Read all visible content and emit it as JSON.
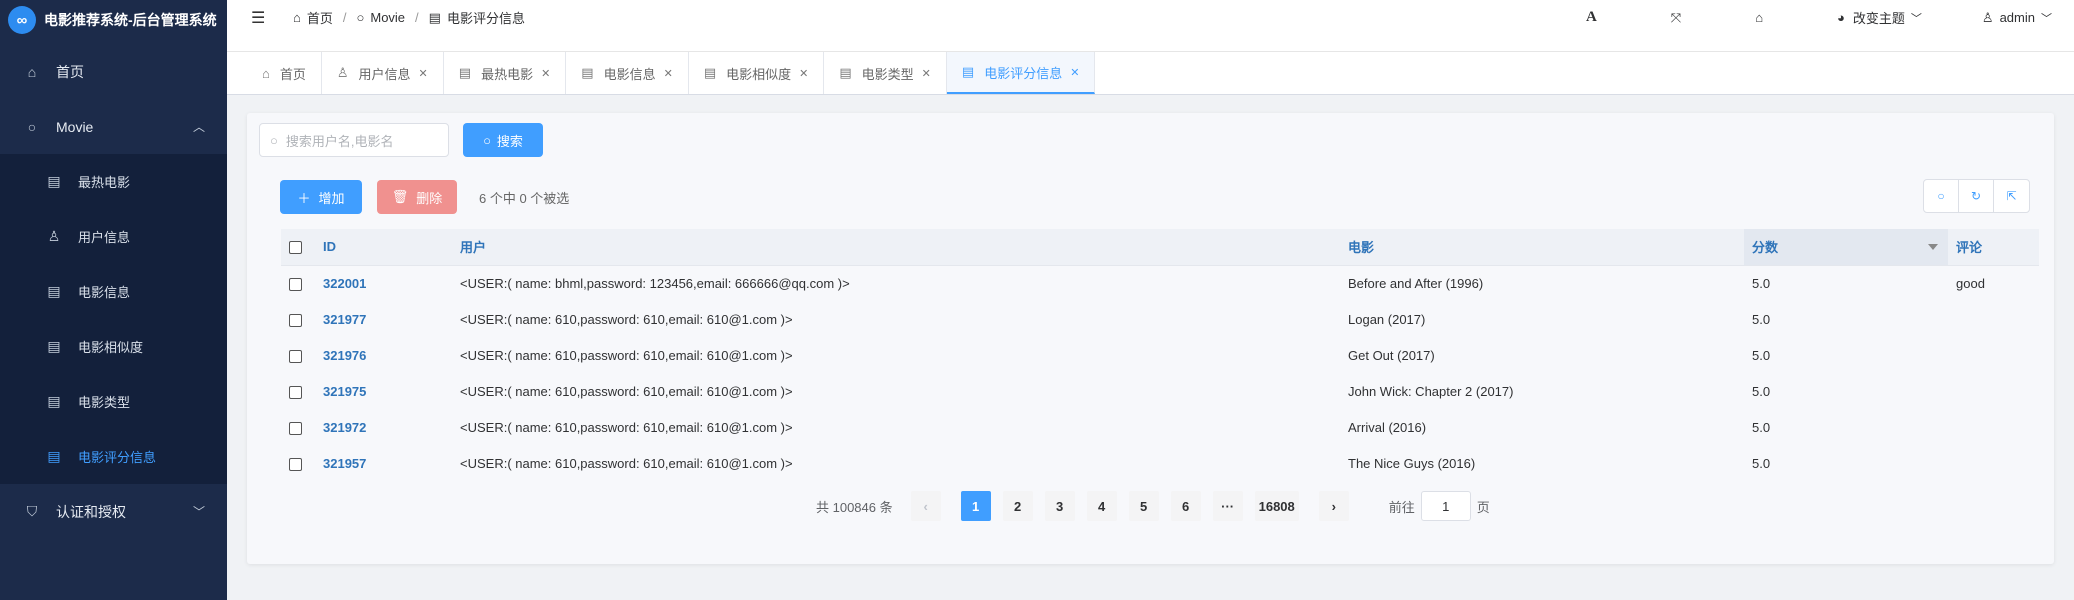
{
  "sidebar": {
    "logo_text": "电影推荐系统-后台管理系统",
    "logo_mark": "∞",
    "items": [
      {
        "label": "首页",
        "icon": "home-icon"
      },
      {
        "label": "Movie",
        "icon": "circle-icon"
      },
      {
        "label": "认证和授权",
        "icon": "shield-icon"
      }
    ],
    "movie_sub": [
      {
        "label": "最热电影",
        "icon": "film-icon"
      },
      {
        "label": "用户信息",
        "icon": "user-icon"
      },
      {
        "label": "电影信息",
        "icon": "film-icon"
      },
      {
        "label": "电影相似度",
        "icon": "film-icon"
      },
      {
        "label": "电影类型",
        "icon": "film-icon"
      },
      {
        "label": "电影评分信息",
        "icon": "film-icon",
        "active": true
      }
    ]
  },
  "navbar": {
    "breadcrumb": [
      "首页",
      "Movie",
      "电影评分信息"
    ],
    "theme_label": "改变主题",
    "user_label": "admin",
    "font_icon": "A"
  },
  "tags": [
    "首页",
    "用户信息",
    "最热电影",
    "电影信息",
    "电影相似度",
    "电影类型",
    "电影评分信息"
  ],
  "search": {
    "placeholder": "搜索用户名,电影名",
    "button": "搜索"
  },
  "toolbar": {
    "add": "增加",
    "delete": "删除",
    "selection": "6 个中 0 个被选"
  },
  "table": {
    "headers": {
      "id": "ID",
      "user": "用户",
      "movie": "电影",
      "score": "分数",
      "comment": "评论"
    },
    "rows": [
      {
        "id": "322001",
        "user": "<USER:( name: bhml,password: 123456,email: 666666@qq.com )>",
        "movie": "Before and After (1996)",
        "score": "5.0",
        "comment": "good"
      },
      {
        "id": "321977",
        "user": "<USER:( name: 610,password: 610,email: 610@1.com )>",
        "movie": "Logan (2017)",
        "score": "5.0",
        "comment": ""
      },
      {
        "id": "321976",
        "user": "<USER:( name: 610,password: 610,email: 610@1.com )>",
        "movie": "Get Out (2017)",
        "score": "5.0",
        "comment": ""
      },
      {
        "id": "321975",
        "user": "<USER:( name: 610,password: 610,email: 610@1.com )>",
        "movie": "John Wick: Chapter 2 (2017)",
        "score": "5.0",
        "comment": ""
      },
      {
        "id": "321972",
        "user": "<USER:( name: 610,password: 610,email: 610@1.com )>",
        "movie": "Arrival (2016)",
        "score": "5.0",
        "comment": ""
      },
      {
        "id": "321957",
        "user": "<USER:( name: 610,password: 610,email: 610@1.com )>",
        "movie": "The Nice Guys (2016)",
        "score": "5.0",
        "comment": ""
      }
    ]
  },
  "pagination": {
    "total": "共 100846 条",
    "pages": [
      "1",
      "2",
      "3",
      "4",
      "5",
      "6",
      "···",
      "16808"
    ],
    "current": "1",
    "goto_prefix": "前往",
    "goto_value": "1",
    "goto_suffix": "页",
    "prev": "‹",
    "next": "›"
  },
  "colors": {
    "accent": "#409eff",
    "sidebar": "#1c2b4a",
    "danger": "#f0918f"
  }
}
